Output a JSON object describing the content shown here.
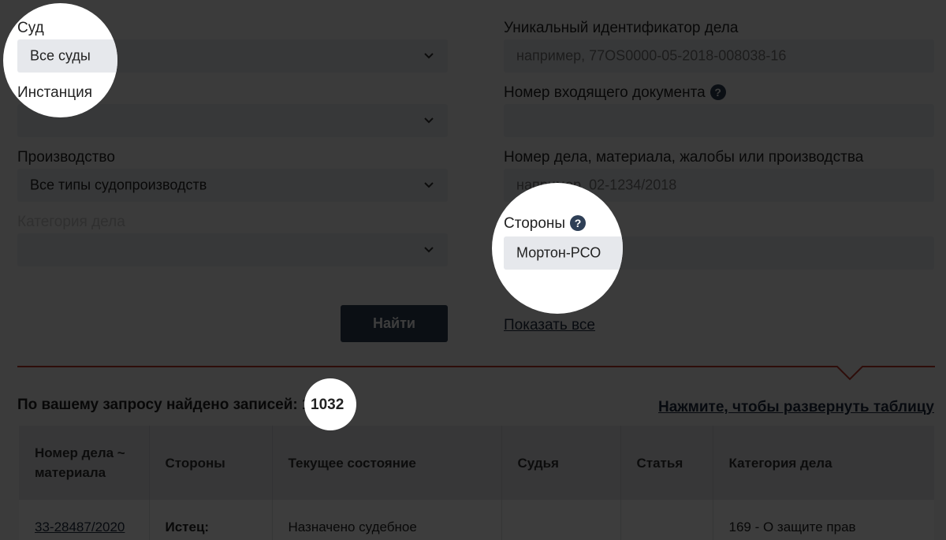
{
  "form": {
    "court": {
      "label": "Суд",
      "value": "Все суды"
    },
    "instance": {
      "label": "Инстанция",
      "value": ""
    },
    "proceeding": {
      "label": "Производство",
      "value": "Все типы судопроизводств"
    },
    "category": {
      "label": "Категория дела",
      "value": ""
    },
    "case_uid": {
      "label": "Уникальный идентификатор дела",
      "placeholder": "например, 77OS0000-05-2018-008038-16"
    },
    "incoming_doc": {
      "label": "Номер входящего документа",
      "placeholder": ""
    },
    "case_number": {
      "label": "Номер дела, материала, жалобы или производства",
      "placeholder": "например, 02-1234/2018"
    },
    "parties": {
      "label": "Стороны",
      "value": "Мортон-РСО"
    },
    "help_glyph": "?",
    "search_button": "Найти",
    "show_all_link": "Показать все"
  },
  "results": {
    "count_prefix": "По вашему запросу найдено записей:",
    "count": "1032",
    "expand_link": "Нажмите, чтобы развернуть таблицу"
  },
  "table": {
    "headers": [
      "Номер дела ~ материала",
      "Стороны",
      "Текущее состояние",
      "Судья",
      "Статья",
      "Категория дела"
    ],
    "rows": [
      [
        "33-28487/2020",
        "Истец:",
        "Назначено судебное",
        "",
        "",
        "169 - О защите прав"
      ]
    ]
  },
  "colors": {
    "accent_line": "#c0392b",
    "button": "#2e3f56",
    "field_bg": "#e6e8ec"
  }
}
